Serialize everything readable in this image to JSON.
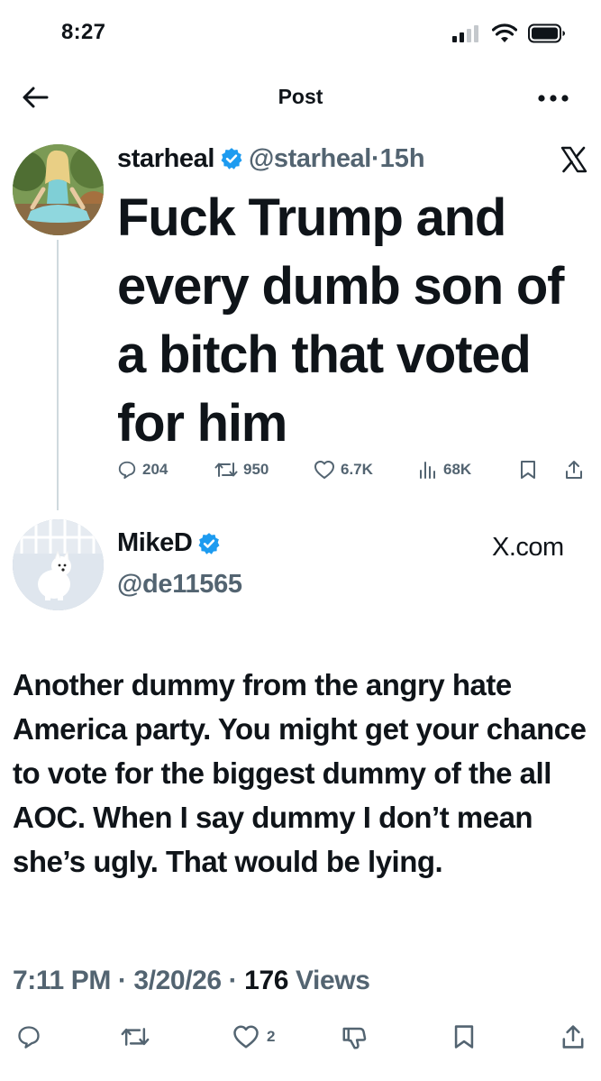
{
  "status_bar": {
    "time": "8:27",
    "icons": [
      "cellular-signal-icon",
      "wifi-icon",
      "battery-icon"
    ]
  },
  "header": {
    "title": "Post",
    "back_icon": "back-arrow-icon",
    "more_icon": "more-icon"
  },
  "quoted_post": {
    "author_name": "starheal",
    "author_handle": "@starheal",
    "separator": "·",
    "time": "15h",
    "verified": true,
    "text": "Fuck Trump and every dumb son of a bitch that voted for him",
    "platform_icon": "x-logo-icon",
    "actions": {
      "replies": "204",
      "reposts": "950",
      "likes": "6.7K",
      "views": "68K"
    }
  },
  "reply": {
    "author_name": "MikeD",
    "author_handle": "@de11565",
    "verified": true,
    "source": "X.com",
    "text": "Another dummy from the angry hate America party. You might get your chance to vote for the biggest dummy of the all AOC. When I say dummy I don’t mean she’s ugly. That would be lying.",
    "time": "7:11 PM",
    "sep1": " · ",
    "date": "3/20/26",
    "sep2": " · ",
    "views_count": "176",
    "views_label": " Views",
    "actions": {
      "likes": "2"
    }
  },
  "colors": {
    "text": "#0f1419",
    "muted": "#536471",
    "verified": "#1d9bf0",
    "line": "#cfd9de"
  }
}
